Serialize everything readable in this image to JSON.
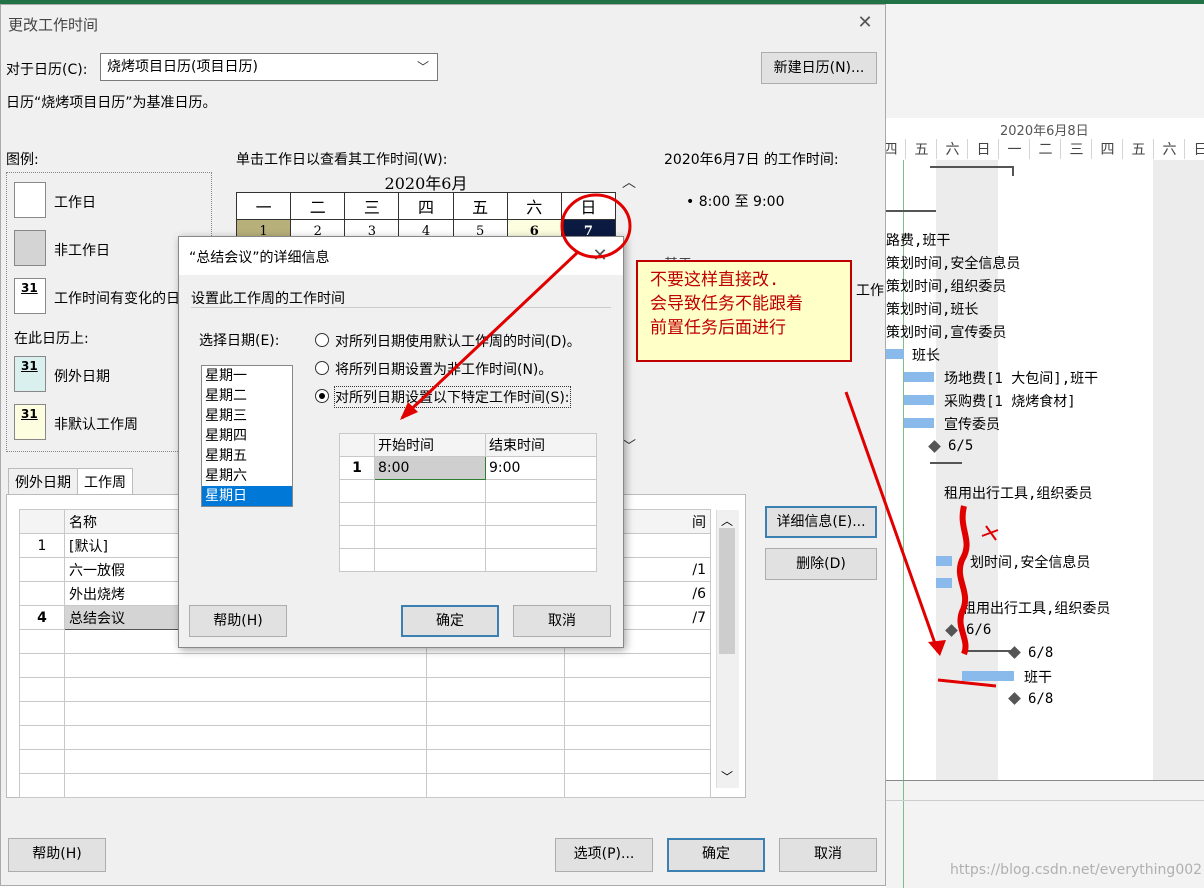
{
  "main_dialog": {
    "title": "更改工作时间",
    "for_calendar_label": "对于日历(C):",
    "calendar_value": "烧烤项目日历(项目日历)",
    "new_calendar_button": "新建日历(N)...",
    "base_calendar_note": "日历“烧烤项目日历”为基准日历。",
    "legend_title": "图例:",
    "legend_items": [
      {
        "label": "工作日",
        "num": ""
      },
      {
        "label": "非工作日",
        "num": ""
      },
      {
        "label": "工作时间有变化的日",
        "num": "31"
      }
    ],
    "on_calendar_label": "在此日历上:",
    "on_calendar_items": [
      {
        "label": "例外日期",
        "num": "31"
      },
      {
        "label": "非默认工作周",
        "num": "31"
      }
    ],
    "calendar_instruction": "单击工作日以查看其工作时间(W):",
    "month_title": "2020年6月",
    "weekday_headers": [
      "一",
      "二",
      "三",
      "四",
      "五",
      "六",
      "日"
    ],
    "first_week": [
      "1",
      "2",
      "3",
      "4",
      "5",
      "6",
      "7"
    ],
    "hidden_label": "基于",
    "work_time_heading": "2020年6月7日 的工作时间:",
    "work_time_value": "• 8:00 至 9:00",
    "tabs": [
      "例外日期",
      "工作周"
    ],
    "grid_header_name": "名称",
    "grid_header_end": "间",
    "grid_rows": [
      {
        "num": "1",
        "name": "[默认]",
        "end": ""
      },
      {
        "num": "",
        "name": "六一放假",
        "end": "/1"
      },
      {
        "num": "",
        "name": "外出烧烤",
        "end": "/6"
      },
      {
        "num": "4",
        "name": "总结会议",
        "end": "/7"
      }
    ],
    "details_button": "详细信息(E)...",
    "delete_button": "删除(D)",
    "help_button": "帮助(H)",
    "options_button": "选项(P)...",
    "ok_button": "确定",
    "cancel_button": "取消"
  },
  "detail_dialog": {
    "title": "“总结会议”的详细信息",
    "section_label": "设置此工作周的工作时间",
    "select_days_label": "选择日期(E):",
    "days": [
      "星期一",
      "星期二",
      "星期三",
      "星期四",
      "星期五",
      "星期六",
      "星期日"
    ],
    "selected_day": "星期日",
    "options": [
      {
        "label": "对所列日期使用默认工作周的时间(D)。",
        "selected": false
      },
      {
        "label": "将所列日期设置为非工作时间(N)。",
        "selected": false
      },
      {
        "label": "对所列日期设置以下特定工作时间(S):",
        "selected": true
      }
    ],
    "time_headers": [
      "开始时间",
      "结束时间"
    ],
    "time_rows": [
      {
        "num": "1",
        "start": "8:00",
        "end": "9:00"
      }
    ],
    "help_button": "帮助(H)",
    "ok_button": "确定",
    "cancel_button": "取消"
  },
  "annotation": {
    "lines": [
      "不要这样直接改.",
      "会导致任务不能跟着",
      "前置任务后面进行"
    ],
    "color": "#c00000"
  },
  "gantt": {
    "date_header": "2020年6月8日",
    "day_headers": [
      "四",
      "五",
      "六",
      "日",
      "一",
      "二",
      "三",
      "四",
      "五",
      "六",
      "日"
    ],
    "partial_label": "工作",
    "tasks": [
      "路费,班干",
      "策划时间,安全信息员",
      "策划时间,组织委员",
      "策划时间,班长",
      "策划时间,宣传委员",
      "班长",
      "场地费[1 大包间],班干",
      "采购费[1 烧烤食材]",
      "宣传委员",
      "6/5",
      "租用出行工具,组织委员",
      "划时间,安全信息员",
      "租用出行工具,组织委员",
      "6/6",
      "6/8",
      "班干",
      "6/8"
    ],
    "watermark": "https://blog.csdn.net/everything002"
  }
}
